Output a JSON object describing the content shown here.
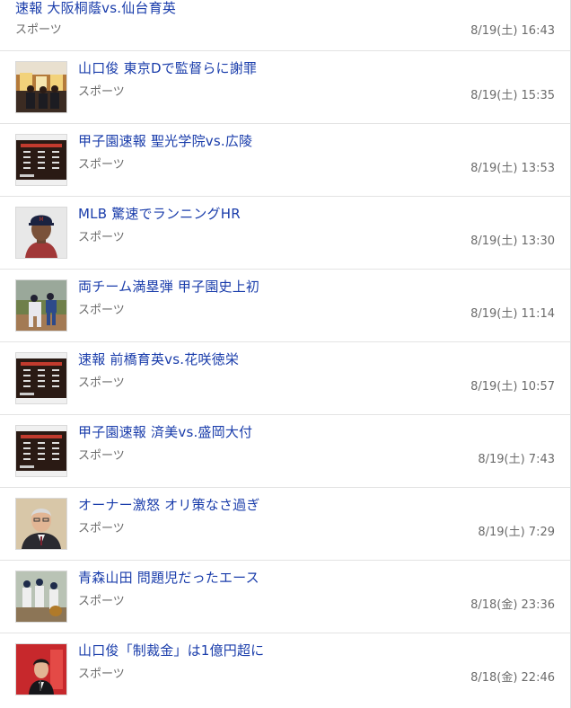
{
  "news": [
    {
      "title": "速報 大阪桐蔭vs.仙台育英",
      "category": "スポーツ",
      "time": "8/19(土) 16:43",
      "thumb": "none"
    },
    {
      "title": "山口俊 東京Dで監督らに謝罪",
      "category": "スポーツ",
      "time": "8/19(土) 15:35",
      "thumb": "press-conference-photo"
    },
    {
      "title": "甲子園速報 聖光学院vs.広陵",
      "category": "スポーツ",
      "time": "8/19(土) 13:53",
      "thumb": "scoreboard-photo"
    },
    {
      "title": "MLB 驚速でランニングHR",
      "category": "スポーツ",
      "time": "8/19(土) 13:30",
      "thumb": "player-portrait-photo"
    },
    {
      "title": "両チーム満塁弾 甲子園史上初",
      "category": "スポーツ",
      "time": "8/19(土) 11:14",
      "thumb": "baseball-action-photo"
    },
    {
      "title": "速報 前橋育英vs.花咲徳栄",
      "category": "スポーツ",
      "time": "8/19(土) 10:57",
      "thumb": "scoreboard-photo"
    },
    {
      "title": "甲子園速報 済美vs.盛岡大付",
      "category": "スポーツ",
      "time": "8/19(土) 7:43",
      "thumb": "scoreboard-photo"
    },
    {
      "title": "オーナー激怒 オリ策なさ過ぎ",
      "category": "スポーツ",
      "time": "8/19(土) 7:29",
      "thumb": "owner-portrait-photo"
    },
    {
      "title": "青森山田 問題児だったエース",
      "category": "スポーツ",
      "time": "8/18(金) 23:36",
      "thumb": "baseball-team-photo"
    },
    {
      "title": "山口俊「制裁金」は1億円超に",
      "category": "スポーツ",
      "time": "8/18(金) 22:46",
      "thumb": "speaker-photo"
    }
  ]
}
